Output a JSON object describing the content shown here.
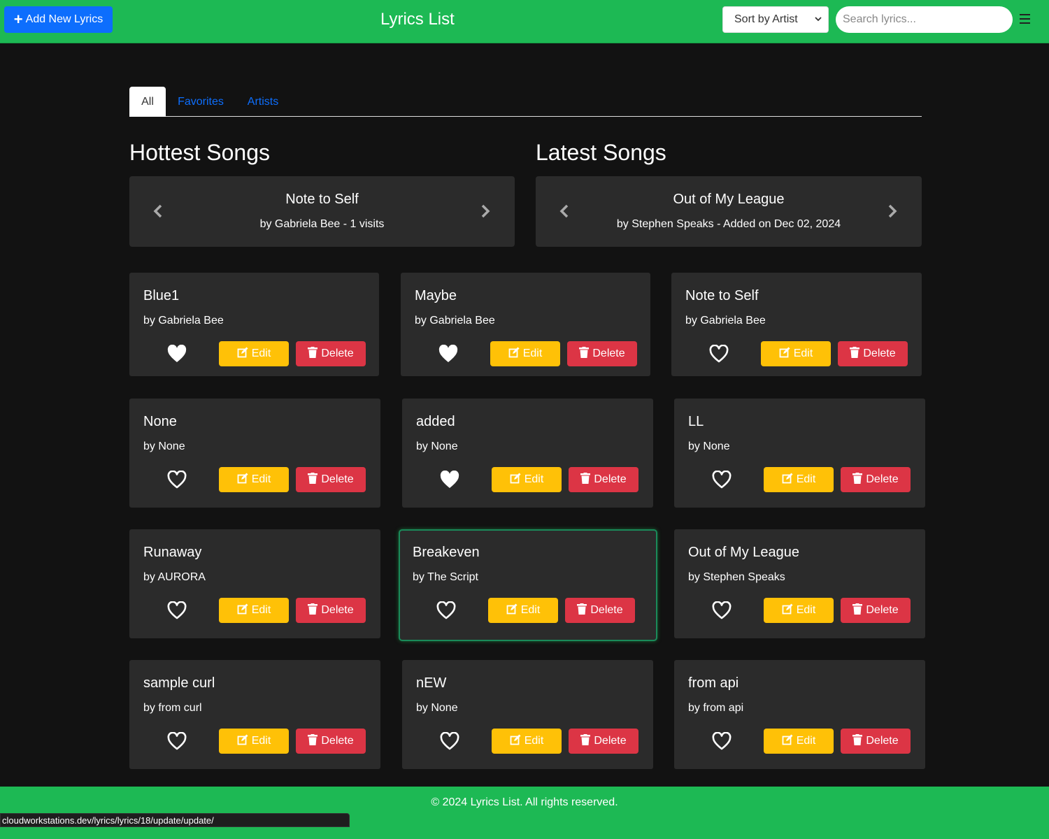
{
  "navbar": {
    "add_label": "Add New Lyrics",
    "brand": "Lyrics List",
    "sort_value": "Sort by Artist",
    "search_placeholder": "Search lyrics..."
  },
  "tabs": [
    {
      "label": "All",
      "active": true
    },
    {
      "label": "Favorites",
      "active": false
    },
    {
      "label": "Artists",
      "active": false
    }
  ],
  "hottest": {
    "heading": "Hottest Songs",
    "title": "Note to Self",
    "subtitle": "by Gabriela Bee - 1 visits"
  },
  "latest": {
    "heading": "Latest Songs",
    "title": "Out of My League",
    "subtitle": "by Stephen Speaks - Added on Dec 02, 2024"
  },
  "buttons": {
    "edit": "Edit",
    "delete": "Delete"
  },
  "cards": [
    {
      "title": "Blue1",
      "artist": "by Gabriela Bee",
      "favorite": true
    },
    {
      "title": "Maybe",
      "artist": "by Gabriela Bee",
      "favorite": true
    },
    {
      "title": "Note to Self",
      "artist": "by Gabriela Bee",
      "favorite": false
    },
    {
      "title": "None",
      "artist": "by None",
      "favorite": false
    },
    {
      "title": "added",
      "artist": "by None",
      "favorite": true
    },
    {
      "title": "LL",
      "artist": "by None",
      "favorite": false
    },
    {
      "title": "Runaway",
      "artist": "by AURORA",
      "favorite": false
    },
    {
      "title": "Breakeven",
      "artist": "by The Script",
      "favorite": false,
      "highlighted": true
    },
    {
      "title": "Out of My League",
      "artist": "by Stephen Speaks",
      "favorite": false
    },
    {
      "title": "sample curl",
      "artist": "by from curl",
      "favorite": false
    },
    {
      "title": "nEW",
      "artist": "by None",
      "favorite": false
    },
    {
      "title": "from api",
      "artist": "by from api",
      "favorite": false
    }
  ],
  "footer": {
    "text": "© 2024 Lyrics List. All rights reserved."
  },
  "status_url": "cloudworkstations.dev/lyrics/lyrics/18/update/update/",
  "colors": {
    "brand_green": "#1db954",
    "primary": "#0d6efd",
    "warning": "#ffc107",
    "danger": "#dc3545",
    "card_bg": "#2b2b2b",
    "page_bg": "#121212"
  }
}
